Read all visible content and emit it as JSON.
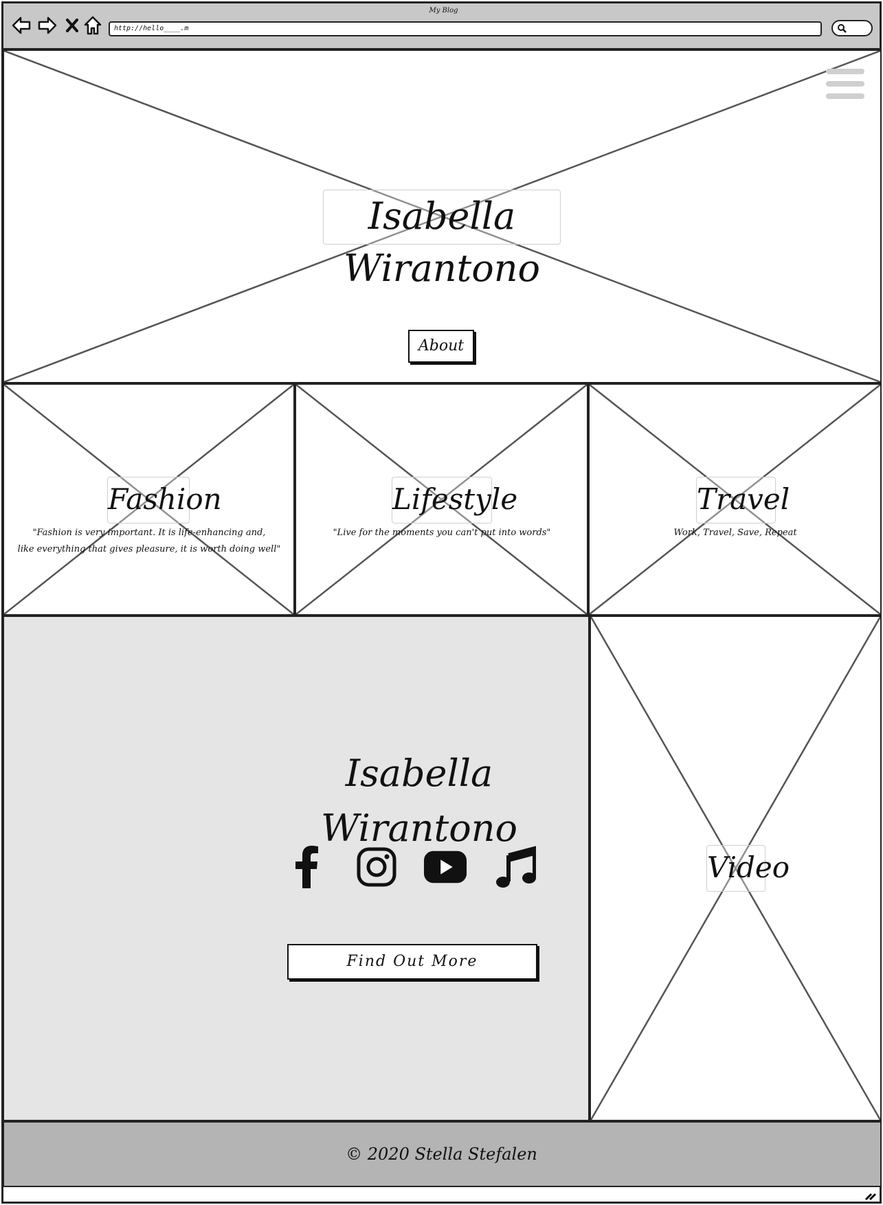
{
  "browser": {
    "window_title": "My Blog",
    "url": "http://hello____.m",
    "icons": [
      "back-arrow-icon",
      "forward-arrow-icon",
      "close-x-icon",
      "home-icon",
      "search-icon"
    ]
  },
  "hero": {
    "title": "Isabella Wirantono",
    "about_label": "About",
    "menu_icon": "hamburger-menu-icon"
  },
  "categories": [
    {
      "title": "Fashion",
      "quote_line1": "\"Fashion is very important. It is life-enhancing and,",
      "quote_line2": "like everything that gives pleasure, it is worth doing well\""
    },
    {
      "title": "Lifestyle",
      "quote_line1": "\"Live for the moments you can't put into words\""
    },
    {
      "title": "Travel",
      "quote_line1": "Work, Travel, Save, Repeat"
    }
  ],
  "promo": {
    "name": "Isabella Wirantono",
    "social_icons": [
      "facebook-icon",
      "instagram-icon",
      "youtube-icon",
      "music-note-icon"
    ],
    "button_label": "Find Out More"
  },
  "video": {
    "title": "Video"
  },
  "footer": {
    "text": "© 2020 Stella Stefalen"
  },
  "colors": {
    "chrome": "#c8c8c8",
    "promo_bg": "#e5e5e5",
    "footer_bg": "#b4b4b4",
    "placeholder_line": "#555555",
    "ink": "#111111"
  }
}
